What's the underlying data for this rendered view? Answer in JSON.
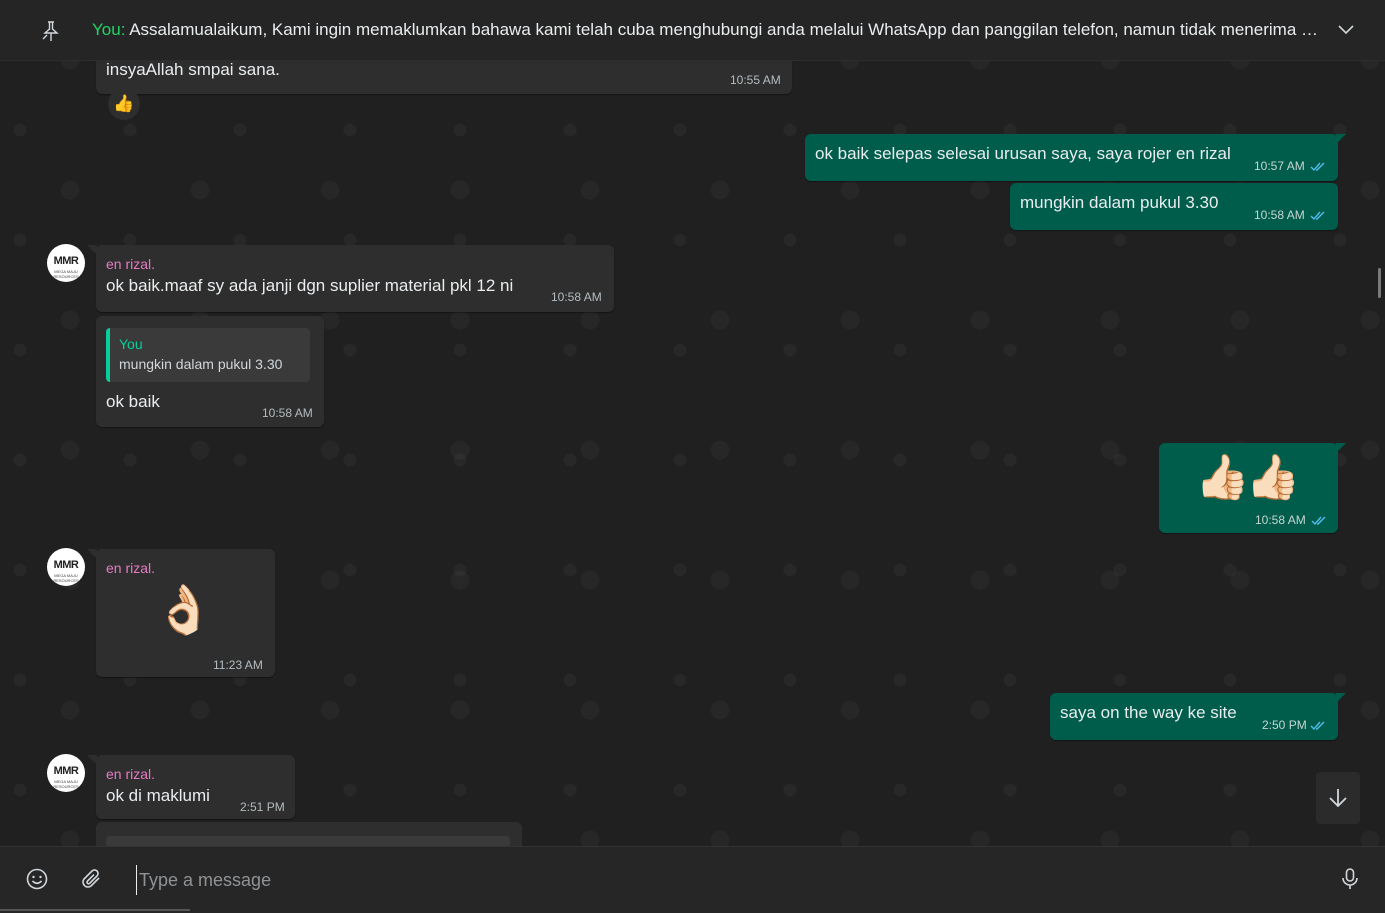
{
  "pinned": {
    "sender": "You:",
    "text": "Assalamualaikum,  Kami ingin memaklumkan bahawa kami telah cuba menghubungi anda melalui WhatsApp dan panggilan telefon, namun tidak menerima sebarang maklum balas."
  },
  "avatar": {
    "initials": "MMR",
    "subtitle": "MEGA MAJU RESOURCES"
  },
  "messages": {
    "m1": {
      "text": "insyaAllah smpai sana.",
      "time": "10:55 AM",
      "reaction": "👍"
    },
    "m2": {
      "text": "ok baik selepas selesai urusan saya, saya rojer en rizal",
      "time": "10:57 AM"
    },
    "m3": {
      "text": "mungkin dalam pukul 3.30",
      "time": "10:58 AM"
    },
    "m4": {
      "sender": "en rizal.",
      "text": "ok baik.maaf sy ada janji dgn suplier material pkl 12 ni",
      "time": "10:58 AM"
    },
    "m5": {
      "quote_author": "You",
      "quote_text": "mungkin dalam pukul 3.30",
      "text": "ok baik",
      "time": "10:58 AM"
    },
    "m6": {
      "emoji": "👍🏻👍🏻",
      "time": "10:58 AM"
    },
    "m7": {
      "sender": "en rizal.",
      "emoji": "👌🏻",
      "time": "11:23 AM"
    },
    "m8": {
      "text": "saya on the way ke site",
      "time": "2:50 PM"
    },
    "m9": {
      "sender": "en rizal.",
      "text": "ok di maklumi",
      "time": "2:51 PM"
    }
  },
  "composer": {
    "placeholder": "Type a message"
  },
  "icons": {
    "pin": "pin-icon",
    "chevron": "chevron-down-icon",
    "ticks": "double-check-icon",
    "scroll": "arrow-down-icon",
    "emoji": "emoji-icon",
    "attach": "paperclip-icon",
    "mic": "microphone-icon"
  },
  "colors": {
    "outgoing": "#005c4b",
    "incoming": "#2e2e2e",
    "sender": "#e87ac4",
    "accent": "#25d366"
  }
}
